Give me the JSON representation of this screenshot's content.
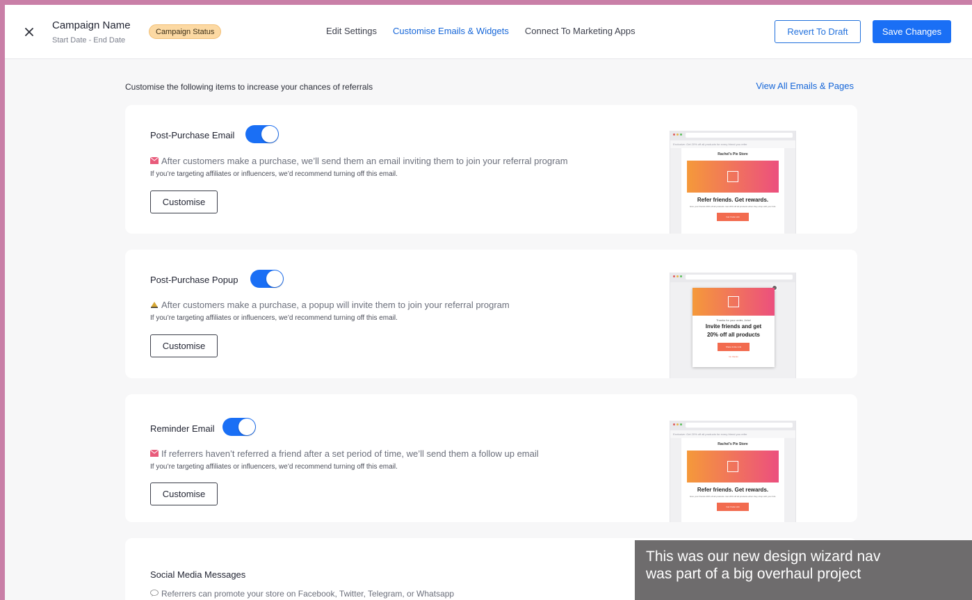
{
  "header": {
    "campaign_name": "Campaign Name",
    "campaign_dates": "Start Date - End Date",
    "status": "Campaign Status",
    "nav": [
      "Edit Settings",
      "Customise Emails & Widgets",
      "Connect To Marketing Apps"
    ],
    "active_nav": "Customise Emails & Widgets",
    "revert_label": "Revert To Draft",
    "save_label": "Save Changes"
  },
  "intro": "Customise the following items to increase your chances of referrals",
  "view_all": "View All Emails & Pages",
  "cards": [
    {
      "title": "Post-Purchase Email",
      "enabled": true,
      "icon": "love-letter-icon",
      "description": "After customers make a purchase, we’ll send them an email inviting them to join your referral program",
      "note": "If you’re targeting affiliates or influencers, we’d recommend turning off this email.",
      "button": "Customise",
      "preview": {
        "topline": "Exclusive: Get 20% off all products for every friend you refer",
        "store": "Rachel's Pie Store",
        "headline": "Refer friends. Get rewards.",
        "body": "Give your friends 20% off all products. Get 20% off all products when they shop with your link.",
        "cta": "Get Invite Link"
      }
    },
    {
      "title": "Post-Purchase Popup",
      "enabled": true,
      "icon": "bell-icon",
      "description": "After customers make a purchase, a popup will invite them to join your referral program",
      "note": "If you’re targeting affiliates or influencers, we’d recommend turning off this email.",
      "button": "Customise",
      "preview": {
        "thanks": "Thanks for your order, John!",
        "headline_line1": "Invite friends and get",
        "headline_line2": "20% off all products",
        "cta": "Share Invite Link",
        "link": "No thanks"
      }
    },
    {
      "title": "Reminder Email",
      "enabled": true,
      "icon": "love-letter-icon",
      "description": "If referrers haven’t referred a friend after a set period of time, we’ll send them a follow up email",
      "note": "If you’re targeting affiliates or influencers, we’d recommend turning off this email.",
      "button": "Customise",
      "preview": {
        "topline": "Exclusive: Get 20% off all products for every friend you refer",
        "store": "Rachel's Pie Store",
        "headline": "Refer friends. Get rewards.",
        "body": "Give your friends 20% off all products. Get 20% off all products when they shop with your link.",
        "cta": "Get Invite Link"
      }
    },
    {
      "title": "Social Media Messages",
      "icon": "speech-bubble-icon",
      "description": "Referrers can promote your store on Facebook, Twitter, Telegram, or Whatsapp"
    }
  ],
  "overlay": {
    "line1": "This was our new design wizard nav",
    "line2": "was part of a big overhaul project"
  },
  "colors": {
    "accent": "#1a6ff5",
    "active_nav": "#1465d8",
    "badge": "#fcd9a3",
    "frame": "#c97fa7"
  }
}
